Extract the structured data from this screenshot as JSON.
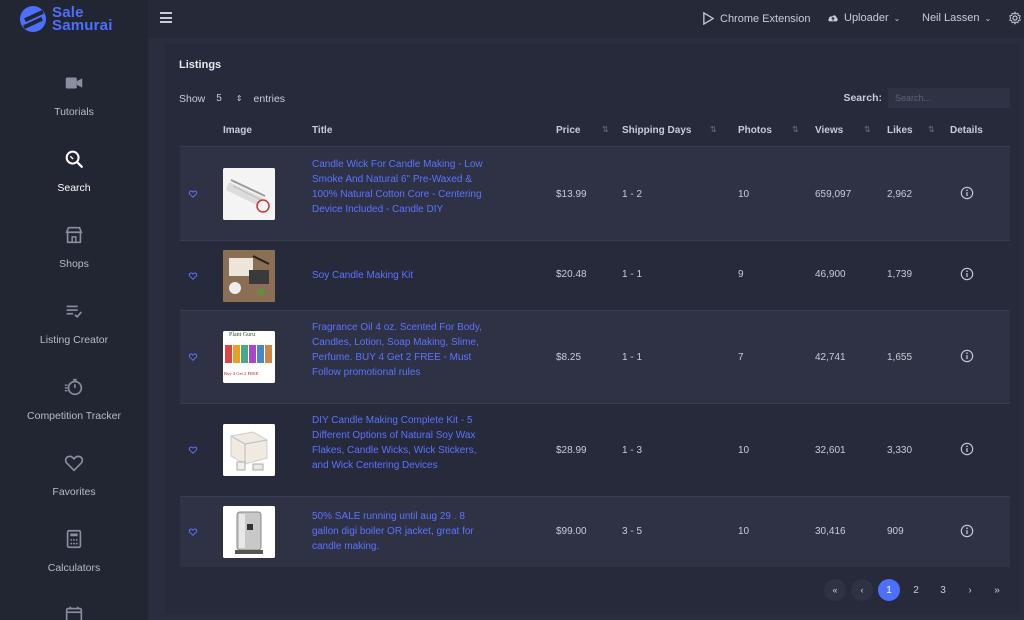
{
  "app": {
    "logo_line1": "Sale",
    "logo_line2": "Samurai"
  },
  "sidebar": {
    "items": [
      {
        "label": "Tutorials",
        "icon": "video-icon"
      },
      {
        "label": "Search",
        "icon": "search-icon"
      },
      {
        "label": "Shops",
        "icon": "store-icon"
      },
      {
        "label": "Listing Creator",
        "icon": "list-check-icon"
      },
      {
        "label": "Competition Tracker",
        "icon": "stopwatch-icon"
      },
      {
        "label": "Favorites",
        "icon": "heart-icon"
      },
      {
        "label": "Calculators",
        "icon": "calculator-icon"
      }
    ]
  },
  "topbar": {
    "chrome_extension": "Chrome Extension",
    "uploader": "Uploader",
    "user": "Neil Lassen"
  },
  "listings": {
    "title": "Listings",
    "show_label": "Show",
    "entries_value": "5",
    "entries_label": "entries",
    "search_label": "Search:",
    "search_placeholder": "Search...",
    "columns": [
      "Image",
      "Title",
      "Price",
      "Shipping Days",
      "Photos",
      "Views",
      "Likes",
      "Details"
    ],
    "rows": [
      {
        "title": "Candle Wick For Candle Making - Low Smoke And Natural 6\" Pre-Waxed & 100% Natural Cotton Core - Centering Device Included - Candle DIY",
        "price": "$13.99",
        "shipping": "1 - 2",
        "photos": "10",
        "views": "659,097",
        "likes": "2,962"
      },
      {
        "title": "Soy Candle Making Kit",
        "price": "$20.48",
        "shipping": "1 - 1",
        "photos": "9",
        "views": "46,900",
        "likes": "1,739"
      },
      {
        "title": "Fragrance Oil 4 oz. Scented For Body, Candles, Lotion, Soap Making, Slime, Perfume. BUY 4 Get 2 FREE - Must Follow promotional rules",
        "price": "$8.25",
        "shipping": "1 - 1",
        "photos": "7",
        "views": "42,741",
        "likes": "1,655"
      },
      {
        "title": "DIY Candle Making Complete Kit - 5 Different Options of Natural Soy Wax Flakes, Candle Wicks, Wick Stickers, and Wick Centering Devices",
        "price": "$28.99",
        "shipping": "1 - 3",
        "photos": "10",
        "views": "32,601",
        "likes": "3,330"
      },
      {
        "title": "50% SALE running until aug 29 . 8 gallon digi boiler OR jacket, great for candle making.",
        "price": "$99.00",
        "shipping": "3 - 5",
        "photos": "10",
        "views": "30,416",
        "likes": "909"
      }
    ],
    "thumb_labels": {
      "plant_guru": "Plant Guru",
      "buy_get": "Buy 4 Get 2 FREE"
    }
  },
  "pagination": {
    "first": "«",
    "prev": "‹",
    "pages": [
      "1",
      "2",
      "3"
    ],
    "next": "›",
    "last": "»",
    "active": "1"
  },
  "colors": {
    "accent": "#4c6fff",
    "link": "#5b73ff",
    "sidebar": "#222532",
    "card": "#272a3a"
  }
}
